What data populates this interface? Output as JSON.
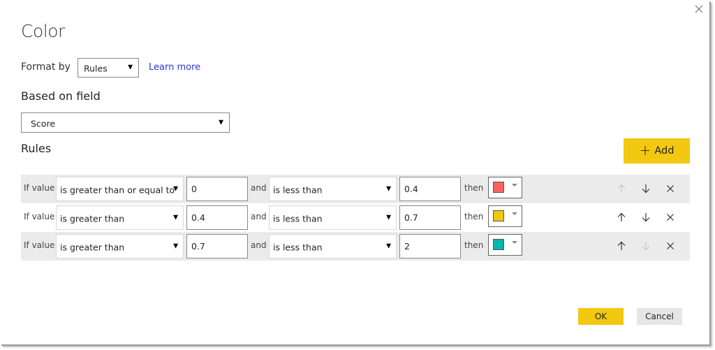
{
  "dialog": {
    "title": "Color",
    "close_icon": "close-icon"
  },
  "format_by": {
    "label": "Format by",
    "selected": "Rules",
    "learn_more": "Learn more"
  },
  "based_on_field": {
    "heading": "Based on field",
    "selected": "Score"
  },
  "rules": {
    "heading": "Rules",
    "add_label": "Add",
    "items": [
      {
        "prefix": "If value",
        "operator1": "is greater than or equal to",
        "value1": "0",
        "conjunction": "and",
        "operator2": "is less than",
        "value2": "0.4",
        "then": "then",
        "color": "#fd625e",
        "up_enabled": false,
        "down_enabled": true
      },
      {
        "prefix": "If value",
        "operator1": "is greater than",
        "value1": "0.4",
        "conjunction": "and",
        "operator2": "is less than",
        "value2": "0.7",
        "then": "then",
        "color": "#f2c80f",
        "up_enabled": true,
        "down_enabled": true
      },
      {
        "prefix": "If value",
        "operator1": "is greater than",
        "value1": "0.7",
        "conjunction": "and",
        "operator2": "is less than",
        "value2": "2",
        "then": "then",
        "color": "#01b8aa",
        "up_enabled": true,
        "down_enabled": false
      }
    ]
  },
  "footer": {
    "ok_label": "OK",
    "cancel_label": "Cancel"
  },
  "colors": {
    "accent": "#f2c811",
    "link": "#2e35d4",
    "row_shade": "#ebebeb",
    "icon_enabled": "#333333",
    "icon_disabled": "#c8c8c8"
  }
}
